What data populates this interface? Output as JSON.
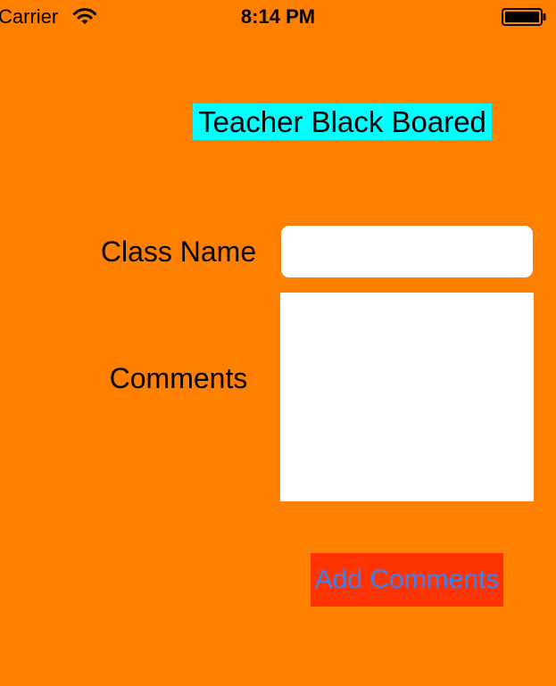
{
  "status_bar": {
    "carrier": "Carrier",
    "time": "8:14 PM",
    "wifi_icon": "wifi-icon",
    "battery_icon": "battery-full-icon"
  },
  "title": "Teacher Black Boared",
  "form": {
    "class_name_label": "Class Name",
    "class_name_value": "",
    "comments_label": "Comments",
    "comments_value": ""
  },
  "add_comments_button": "Add Comments",
  "colors": {
    "background": "#FF7F00",
    "title_background": "#00FFFF",
    "button_background": "#FF3300",
    "button_text": "#3F7FF6",
    "field_background": "#FFFFFF"
  }
}
